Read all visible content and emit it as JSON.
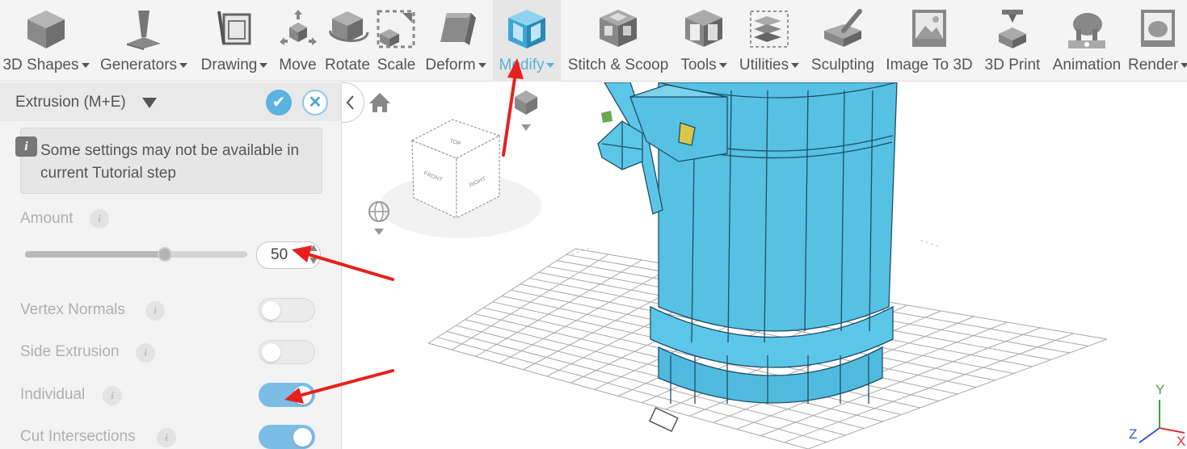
{
  "toolbar": {
    "items": [
      {
        "label": "3D Shapes",
        "icon": "cube-icon",
        "dropdown": true
      },
      {
        "label": "Generators",
        "icon": "generator-icon",
        "dropdown": true
      },
      {
        "label": "Drawing",
        "icon": "drawing-icon",
        "dropdown": true
      },
      {
        "label": "Move",
        "icon": "move-icon",
        "dropdown": false
      },
      {
        "label": "Rotate",
        "icon": "rotate-icon",
        "dropdown": false
      },
      {
        "label": "Scale",
        "icon": "scale-icon",
        "dropdown": false
      },
      {
        "label": "Deform",
        "icon": "deform-icon",
        "dropdown": true
      },
      {
        "label": "Modify",
        "icon": "modify-icon",
        "dropdown": true,
        "active": true
      },
      {
        "label": "Stitch & Scoop",
        "icon": "stitch-scoop-icon",
        "dropdown": false
      },
      {
        "label": "Tools",
        "icon": "tools-icon",
        "dropdown": true
      },
      {
        "label": "Utilities",
        "icon": "utilities-icon",
        "dropdown": true
      },
      {
        "label": "Sculpting",
        "icon": "sculpting-icon",
        "dropdown": false
      },
      {
        "label": "Image To 3D",
        "icon": "image-to-3d-icon",
        "dropdown": false
      },
      {
        "label": "3D Print",
        "icon": "3d-print-icon",
        "dropdown": false
      },
      {
        "label": "Animation",
        "icon": "animation-icon",
        "dropdown": false
      },
      {
        "label": "Render",
        "icon": "render-icon",
        "dropdown": true
      }
    ]
  },
  "panel": {
    "title": "Extrusion (M+E)",
    "info": "Some settings may not be available in current Tutorial step",
    "amount_label": "Amount",
    "amount_value": "50",
    "amount_fraction": 0.63,
    "toggles": [
      {
        "label": "Vertex Normals",
        "on": false
      },
      {
        "label": "Side Extrusion",
        "on": false
      },
      {
        "label": "Individual",
        "on": true
      },
      {
        "label": "Cut Intersections",
        "on": true
      }
    ]
  },
  "viewport": {
    "view_cube": {
      "top": "TOP",
      "front": "FRONT",
      "right": "RIGHT"
    },
    "axes": {
      "x": "X",
      "y": "Y",
      "z": "Z"
    }
  },
  "colors": {
    "accent": "#5ab2e0",
    "model": "#56c1e3",
    "model_edge": "#1e4e66",
    "annotation_arrow": "#e8201c"
  }
}
